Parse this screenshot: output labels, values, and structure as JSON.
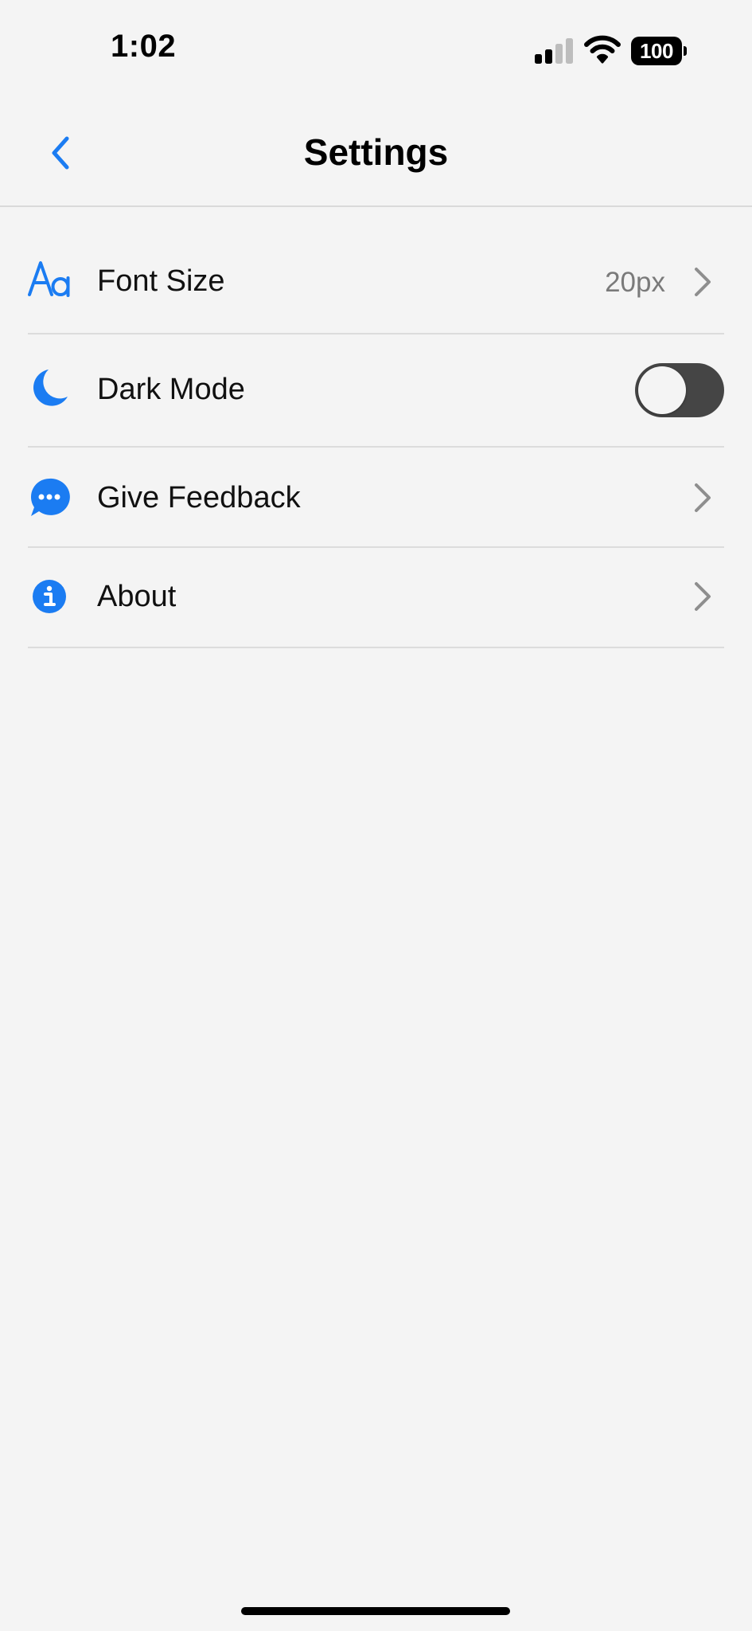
{
  "status_bar": {
    "time": "1:02",
    "battery_level": "100",
    "signal_icon": "cellular-signal-icon",
    "wifi_icon": "wifi-icon"
  },
  "nav": {
    "title": "Settings",
    "back_icon": "chevron-left-icon"
  },
  "accent_color": "#1b7cf2",
  "settings": {
    "font_size": {
      "icon": "text-size-icon",
      "label": "Font Size",
      "value": "20px"
    },
    "dark_mode": {
      "icon": "moon-icon",
      "label": "Dark Mode",
      "enabled": false
    },
    "give_feedback": {
      "icon": "chat-bubble-icon",
      "label": "Give Feedback"
    },
    "about": {
      "icon": "info-icon",
      "label": "About"
    }
  }
}
